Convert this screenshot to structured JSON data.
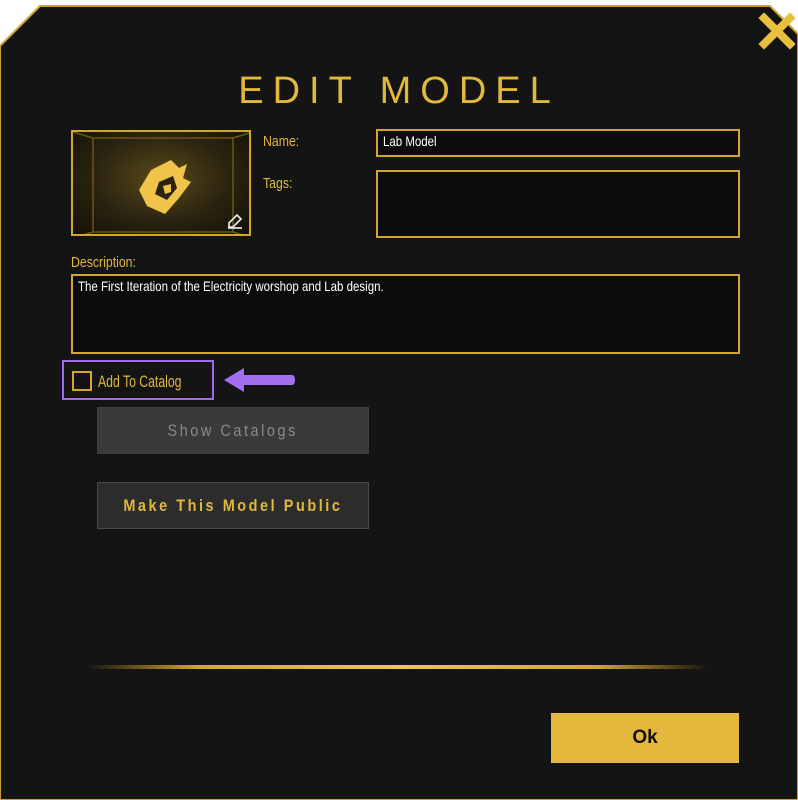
{
  "dialog": {
    "title": "EDIT MODEL",
    "close_icon": "close-x-icon"
  },
  "thumbnail": {
    "logo_icon": "dragon-logo-icon",
    "edit_icon": "edit-pencil-icon"
  },
  "form": {
    "name_label": "Name:",
    "name_value": "Lab Model",
    "tags_label": "Tags:",
    "tags_value": "",
    "description_label": "Description:",
    "description_value": "The First Iteration of the Electricity worshop and Lab design."
  },
  "catalog": {
    "checkbox_label": "Add To Catalog",
    "checked": false,
    "highlight_arrow_icon": "left-arrow-icon"
  },
  "buttons": {
    "show_catalogs": "Show Catalogs",
    "make_public": "Make This Model Public",
    "ok": "Ok"
  },
  "colors": {
    "background": "#141414",
    "gold": "#e0b83c",
    "highlight": "#a06be8",
    "disabled_button": "#3a3a3a"
  }
}
